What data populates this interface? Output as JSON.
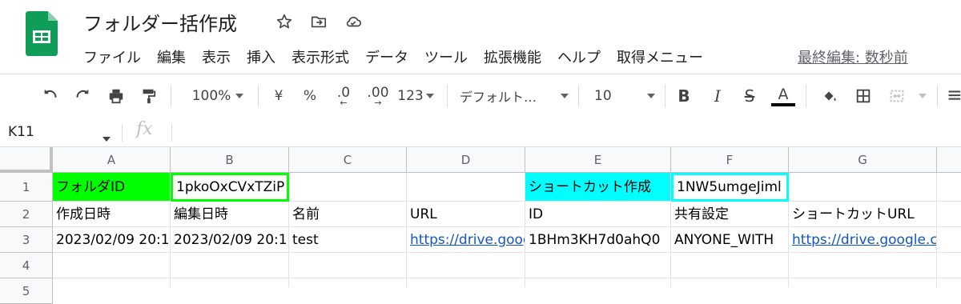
{
  "document": {
    "title": "フォルダー括作成",
    "title_icons": [
      "star-icon",
      "move-folder-icon",
      "cloud-status-icon"
    ],
    "menu": [
      "ファイル",
      "編集",
      "表示",
      "挿入",
      "表示形式",
      "データ",
      "ツール",
      "拡張機能",
      "ヘルプ",
      "取得メニュー"
    ],
    "last_edit": "最終編集: 数秒前"
  },
  "toolbar": {
    "zoom": "100%",
    "currency": "¥",
    "percent": "%",
    "decrease_decimal": ".0",
    "increase_decimal": ".00",
    "more_formats": "123",
    "font": "デフォルト…",
    "font_size": "10",
    "bold": "B",
    "italic": "I",
    "strikethrough": "S",
    "text_color": "A",
    "text_color_value": "#000000"
  },
  "formula_bar": {
    "name_box": "K11",
    "fx": "fx",
    "content": ""
  },
  "sheet": {
    "columns": [
      "A",
      "B",
      "C",
      "D",
      "E",
      "F",
      "G"
    ],
    "rows": [
      "1",
      "2",
      "3",
      "4",
      "5"
    ],
    "cells": {
      "A1": "フォルダID",
      "B1": "1pkoOxCVxTZiP",
      "E1": "ショートカット作成",
      "F1": "1NW5umgeJiml",
      "A2": "作成日時",
      "B2": "編集日時",
      "C2": "名前",
      "D2": "URL",
      "E2": "ID",
      "F2": "共有設定",
      "G2": "ショートカットURL",
      "A3": "2023/02/09 20:1",
      "B3": "2023/02/09 20:1",
      "C3": "test",
      "D3": "https://drive.goog",
      "E3": "1BHm3KH7d0ahQ0",
      "F3": "ANYONE_WITH",
      "G3": "https://drive.google.c"
    },
    "colors": {
      "green": "#00ff00",
      "cyan": "#00ffff",
      "link": "#1155cc"
    }
  }
}
